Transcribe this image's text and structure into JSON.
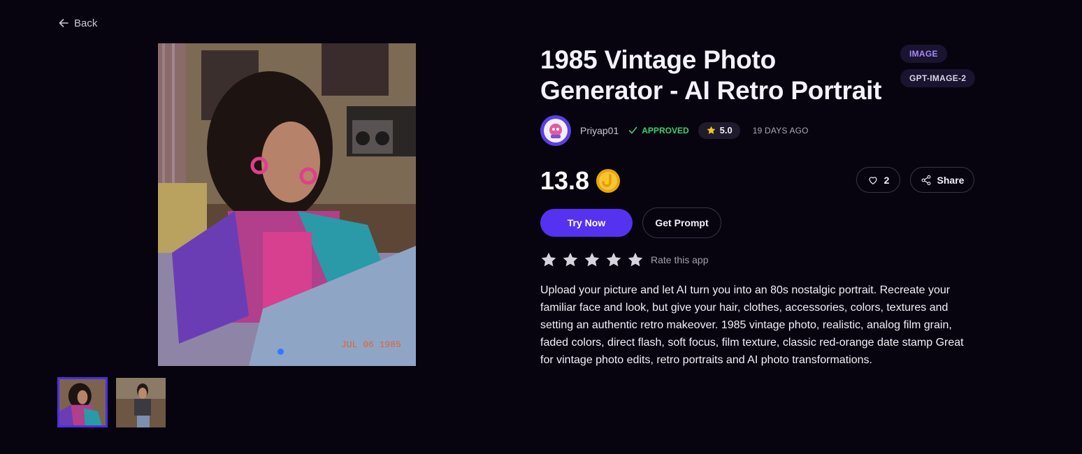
{
  "nav": {
    "back_label": "Back"
  },
  "app": {
    "title": "1985 Vintage Photo Generator - AI Retro Portrait",
    "tags": {
      "type": "IMAGE",
      "model": "GPT-IMAGE-2"
    },
    "author": "Priyap01",
    "status": "APPROVED",
    "rating": "5.0",
    "posted": "19 DAYS AGO",
    "price": "13.8",
    "likes": "2",
    "share_label": "Share",
    "try_label": "Try Now",
    "prompt_label": "Get Prompt",
    "rate_label": "Rate this app",
    "stars_total": 5,
    "description": "Upload your picture and let AI turn you into an 80s nostalgic portrait. Recreate your familiar face and look, but give your hair, clothes, accessories, colors, textures and setting an authentic retro makeover. 1985 vintage photo, realistic, analog film grain, faded colors, direct flash, soft focus, film texture, classic red-orange date stamp Great for vintage photo edits, retro portraits and AI photo transformations."
  },
  "gallery": {
    "date_stamp": "JUL 06 1985",
    "active_index": 0,
    "thumbnails": 2
  },
  "colors": {
    "background": "#07040f",
    "accent": "#5531f0",
    "approved": "#3ccf6e",
    "tag_type": "#a78bfa",
    "coin": "#f5b81c"
  },
  "icons": [
    "arrow-left-icon",
    "check-icon",
    "star-icon",
    "coin-icon",
    "heart-icon",
    "share-icon"
  ]
}
